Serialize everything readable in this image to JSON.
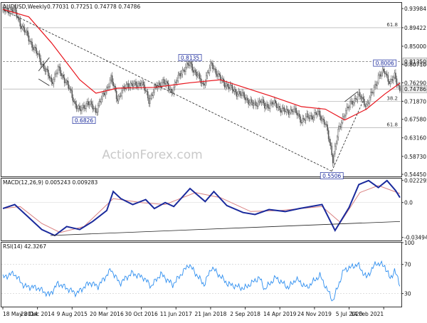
{
  "header": {
    "symbol": "AUDUSD,Weekly",
    "ohlc": "0.77031 0.77251 0.74778 0.74786"
  },
  "watermark": "ActionForex.com",
  "colors": {
    "background": "#ffffff",
    "candle": "#555555",
    "ma_line": "#e8141c",
    "macd_line": "#1a2a9c",
    "signal_line": "#d98080",
    "rsi_line": "#2f8ff0",
    "fib_line": "#b8b8b8",
    "trend_line": "#222222",
    "text": "#111111"
  },
  "chart_data": [
    {
      "type": "candlestick",
      "panel": "price",
      "title": "AUDUSD,Weekly",
      "ylim": [
        0.5395,
        0.9535
      ],
      "y_ticks": [
        0.93984,
        0.89422,
        0.85,
        0.8071,
        0.7629,
        0.7187,
        0.6758,
        0.6316,
        0.5873,
        0.5445
      ],
      "y_tick_labels": [
        "0.93984",
        "0.89422",
        "0.85000",
        "0.80710",
        "0.76290",
        "0.71870",
        "0.67580",
        "0.63160",
        "0.58730",
        "0.54450"
      ],
      "x_tick_labels": [
        "18 May 2014",
        "28 Dec 2014",
        "9 Aug 2015",
        "20 Mar 2016",
        "30 Oct 2016",
        "11 Jun 2017",
        "21 Jan 2018",
        "2 Sep 2018",
        "14 Apr 2019",
        "24 Nov 2019",
        "5 Jul 2020",
        "14 Feb 2021"
      ],
      "close_anchors": [
        {
          "date": "2014-05-18",
          "value": 0.934
        },
        {
          "date": "2014-07-27",
          "value": 0.938
        },
        {
          "date": "2014-09-07",
          "value": 0.905
        },
        {
          "date": "2014-11-02",
          "value": 0.868
        },
        {
          "date": "2015-01-25",
          "value": 0.81
        },
        {
          "date": "2015-03-29",
          "value": 0.765
        },
        {
          "date": "2015-05-10",
          "value": 0.795
        },
        {
          "date": "2015-06-28",
          "value": 0.768
        },
        {
          "date": "2015-08-30",
          "value": 0.712
        },
        {
          "date": "2015-09-27",
          "value": 0.695
        },
        {
          "date": "2015-11-15",
          "value": 0.716
        },
        {
          "date": "2016-01-10",
          "value": 0.697
        },
        {
          "date": "2016-03-13",
          "value": 0.745
        },
        {
          "date": "2016-04-17",
          "value": 0.772
        },
        {
          "date": "2016-05-29",
          "value": 0.725
        },
        {
          "date": "2016-07-31",
          "value": 0.76
        },
        {
          "date": "2016-09-18",
          "value": 0.756
        },
        {
          "date": "2016-10-30",
          "value": 0.765
        },
        {
          "date": "2016-12-18",
          "value": 0.722
        },
        {
          "date": "2017-01-22",
          "value": 0.748
        },
        {
          "date": "2017-03-19",
          "value": 0.767
        },
        {
          "date": "2017-05-14",
          "value": 0.742
        },
        {
          "date": "2017-07-16",
          "value": 0.79
        },
        {
          "date": "2017-09-10",
          "value": 0.808
        },
        {
          "date": "2017-12-03",
          "value": 0.758
        },
        {
          "date": "2018-01-28",
          "value": 0.808
        },
        {
          "date": "2018-03-25",
          "value": 0.77
        },
        {
          "date": "2018-06-17",
          "value": 0.745
        },
        {
          "date": "2018-08-26",
          "value": 0.73
        },
        {
          "date": "2018-10-28",
          "value": 0.708
        },
        {
          "date": "2018-12-09",
          "value": 0.722
        },
        {
          "date": "2019-01-06",
          "value": 0.705
        },
        {
          "date": "2019-02-24",
          "value": 0.715
        },
        {
          "date": "2019-05-26",
          "value": 0.692
        },
        {
          "date": "2019-07-07",
          "value": 0.7
        },
        {
          "date": "2019-09-01",
          "value": 0.674
        },
        {
          "date": "2019-12-15",
          "value": 0.69
        },
        {
          "date": "2020-02-02",
          "value": 0.668
        },
        {
          "date": "2020-03-22",
          "value": 0.581
        },
        {
          "date": "2020-04-19",
          "value": 0.636
        },
        {
          "date": "2020-06-07",
          "value": 0.694
        },
        {
          "date": "2020-07-26",
          "value": 0.716
        },
        {
          "date": "2020-08-30",
          "value": 0.735
        },
        {
          "date": "2020-10-25",
          "value": 0.71
        },
        {
          "date": "2020-12-06",
          "value": 0.742
        },
        {
          "date": "2021-01-10",
          "value": 0.778
        },
        {
          "date": "2021-02-21",
          "value": 0.79
        },
        {
          "date": "2021-03-28",
          "value": 0.762
        },
        {
          "date": "2021-04-25",
          "value": 0.778
        },
        {
          "date": "2021-05-30",
          "value": 0.7478
        }
      ],
      "moving_average_anchors": [
        {
          "date": "2014-05-18",
          "value": 0.938
        },
        {
          "date": "2014-11-02",
          "value": 0.92
        },
        {
          "date": "2015-03-29",
          "value": 0.858
        },
        {
          "date": "2015-09-27",
          "value": 0.77
        },
        {
          "date": "2016-01-10",
          "value": 0.738
        },
        {
          "date": "2016-05-29",
          "value": 0.75
        },
        {
          "date": "2017-01-22",
          "value": 0.752
        },
        {
          "date": "2017-09-10",
          "value": 0.763
        },
        {
          "date": "2018-03-25",
          "value": 0.77
        },
        {
          "date": "2019-02-24",
          "value": 0.73
        },
        {
          "date": "2019-09-01",
          "value": 0.706
        },
        {
          "date": "2020-02-02",
          "value": 0.7
        },
        {
          "date": "2020-06-07",
          "value": 0.674
        },
        {
          "date": "2020-10-25",
          "value": 0.7
        },
        {
          "date": "2021-02-21",
          "value": 0.736
        },
        {
          "date": "2021-05-30",
          "value": 0.762
        }
      ],
      "price_labels": [
        {
          "text": "0.6826",
          "date": "2015-10-25",
          "value": 0.6826
        },
        {
          "text": "0.8135",
          "date": "2017-09-10",
          "value": 0.8135
        },
        {
          "text": "0.5506",
          "date": "2020-03-15",
          "value": 0.5506
        },
        {
          "text": "0.8006",
          "date": "2021-02-21",
          "value": 0.8006
        }
      ],
      "horizontal_levels": [
        {
          "value": 0.89422,
          "label": "61.8",
          "style": "solid",
          "start": "2014-05-18"
        },
        {
          "value": 0.8135,
          "label": "0.81350",
          "style": "dashed",
          "start": "2014-05-18"
        },
        {
          "value": 0.74786,
          "label": "0.74786",
          "style": "solid",
          "start": "2014-05-18"
        },
        {
          "value": 0.7187,
          "label": "38.2",
          "style": "solid",
          "start": "2019-12-15"
        },
        {
          "value": 0.6556,
          "label": "61.8",
          "style": "solid",
          "start": "2020-02-16"
        }
      ],
      "trendlines": [
        {
          "from_date": "2014-05-25",
          "from": 0.936,
          "to_date": "2020-03-15",
          "to": 0.552,
          "style": "dashed"
        },
        {
          "from_date": "2020-03-15",
          "from": 0.552,
          "to_date": "2020-10-04",
          "to": 0.72,
          "style": "dashed"
        },
        {
          "from_date": "2015-01-04",
          "from": 0.791,
          "to_date": "2015-03-15",
          "to": 0.823,
          "style": "solid"
        },
        {
          "from_date": "2015-01-04",
          "from": 0.772,
          "to_date": "2015-03-15",
          "to": 0.756,
          "style": "solid"
        },
        {
          "from_date": "2020-06-07",
          "from": 0.718,
          "to_date": "2020-08-30",
          "to": 0.742,
          "style": "solid"
        }
      ]
    },
    {
      "type": "line",
      "panel": "macd",
      "title": "MACD(12,26,9) 0.005243 0.009283",
      "ylim": [
        -0.038,
        0.024
      ],
      "y_ticks": [
        0.022295,
        0.0,
        -0.034948
      ],
      "y_tick_labels": [
        "0.022295",
        "0.0",
        "-0.034948"
      ],
      "series": [
        {
          "role": "macd",
          "points": [
            {
              "date": "2014-05-18",
              "value": -0.006
            },
            {
              "date": "2014-08-03",
              "value": -0.002
            },
            {
              "date": "2014-10-19",
              "value": -0.013
            },
            {
              "date": "2015-01-25",
              "value": -0.027
            },
            {
              "date": "2015-04-19",
              "value": -0.033
            },
            {
              "date": "2015-07-05",
              "value": -0.024
            },
            {
              "date": "2015-09-27",
              "value": -0.027
            },
            {
              "date": "2015-12-20",
              "value": -0.019
            },
            {
              "date": "2016-03-20",
              "value": -0.008
            },
            {
              "date": "2016-05-01",
              "value": 0.011
            },
            {
              "date": "2016-06-19",
              "value": 0.004
            },
            {
              "date": "2016-09-04",
              "value": -0.002
            },
            {
              "date": "2016-11-27",
              "value": 0.003
            },
            {
              "date": "2017-01-22",
              "value": -0.006
            },
            {
              "date": "2017-04-02",
              "value": 0.0
            },
            {
              "date": "2017-05-28",
              "value": -0.004
            },
            {
              "date": "2017-09-10",
              "value": 0.014
            },
            {
              "date": "2017-12-17",
              "value": 0.001
            },
            {
              "date": "2018-02-11",
              "value": 0.011
            },
            {
              "date": "2018-05-06",
              "value": -0.003
            },
            {
              "date": "2018-08-19",
              "value": -0.01
            },
            {
              "date": "2018-11-04",
              "value": -0.012
            },
            {
              "date": "2019-02-03",
              "value": -0.007
            },
            {
              "date": "2019-05-19",
              "value": -0.009
            },
            {
              "date": "2019-08-18",
              "value": -0.006
            },
            {
              "date": "2020-01-12",
              "value": -0.002
            },
            {
              "date": "2020-04-05",
              "value": -0.028
            },
            {
              "date": "2020-07-05",
              "value": -0.005
            },
            {
              "date": "2020-09-06",
              "value": 0.018
            },
            {
              "date": "2020-11-08",
              "value": 0.022
            },
            {
              "date": "2021-01-10",
              "value": 0.015
            },
            {
              "date": "2021-03-07",
              "value": 0.022
            },
            {
              "date": "2021-05-02",
              "value": 0.012
            },
            {
              "date": "2021-05-30",
              "value": 0.005
            }
          ]
        },
        {
          "role": "signal",
          "points": [
            {
              "date": "2014-05-18",
              "value": -0.006
            },
            {
              "date": "2014-09-07",
              "value": -0.004
            },
            {
              "date": "2015-01-25",
              "value": -0.021
            },
            {
              "date": "2015-05-24",
              "value": -0.03
            },
            {
              "date": "2015-10-25",
              "value": -0.024
            },
            {
              "date": "2016-05-01",
              "value": 0.004
            },
            {
              "date": "2016-10-30",
              "value": 0.0
            },
            {
              "date": "2017-04-02",
              "value": -0.002
            },
            {
              "date": "2017-10-15",
              "value": 0.01
            },
            {
              "date": "2018-03-25",
              "value": 0.005
            },
            {
              "date": "2018-10-07",
              "value": -0.009
            },
            {
              "date": "2019-04-14",
              "value": -0.008
            },
            {
              "date": "2020-01-12",
              "value": -0.004
            },
            {
              "date": "2020-05-10",
              "value": -0.02
            },
            {
              "date": "2020-09-13",
              "value": 0.01
            },
            {
              "date": "2021-01-10",
              "value": 0.017
            },
            {
              "date": "2021-05-30",
              "value": 0.009
            }
          ]
        }
      ],
      "trendlines": [
        {
          "from_date": "2015-03-22",
          "from": -0.033,
          "to_date": "2021-05-30",
          "to": -0.019
        }
      ]
    },
    {
      "type": "line",
      "panel": "rsi",
      "title": "RSI(14) 42.3267",
      "ylim": [
        12,
        100
      ],
      "y_ticks": [
        100,
        70,
        30
      ],
      "y_tick_labels": [
        "100",
        "70",
        "30"
      ],
      "series": [
        {
          "role": "rsi",
          "points": [
            {
              "date": "2014-05-18",
              "value": 52
            },
            {
              "date": "2014-07-27",
              "value": 58
            },
            {
              "date": "2014-10-05",
              "value": 40
            },
            {
              "date": "2014-12-28",
              "value": 38
            },
            {
              "date": "2015-03-15",
              "value": 28
            },
            {
              "date": "2015-05-10",
              "value": 44
            },
            {
              "date": "2015-09-06",
              "value": 30
            },
            {
              "date": "2015-11-29",
              "value": 45
            },
            {
              "date": "2016-01-24",
              "value": 40
            },
            {
              "date": "2016-04-17",
              "value": 63
            },
            {
              "date": "2016-06-12",
              "value": 44
            },
            {
              "date": "2016-08-28",
              "value": 58
            },
            {
              "date": "2016-11-13",
              "value": 52
            },
            {
              "date": "2017-01-01",
              "value": 40
            },
            {
              "date": "2017-03-05",
              "value": 57
            },
            {
              "date": "2017-05-21",
              "value": 42
            },
            {
              "date": "2017-09-03",
              "value": 70
            },
            {
              "date": "2017-12-10",
              "value": 42
            },
            {
              "date": "2018-01-28",
              "value": 66
            },
            {
              "date": "2018-05-13",
              "value": 43
            },
            {
              "date": "2018-08-26",
              "value": 37
            },
            {
              "date": "2018-12-02",
              "value": 52
            },
            {
              "date": "2019-01-06",
              "value": 36
            },
            {
              "date": "2019-03-17",
              "value": 52
            },
            {
              "date": "2019-06-09",
              "value": 38
            },
            {
              "date": "2019-07-28",
              "value": 50
            },
            {
              "date": "2019-10-06",
              "value": 38
            },
            {
              "date": "2019-12-29",
              "value": 55
            },
            {
              "date": "2020-03-22",
              "value": 20
            },
            {
              "date": "2020-05-31",
              "value": 62
            },
            {
              "date": "2020-08-30",
              "value": 70
            },
            {
              "date": "2020-10-25",
              "value": 52
            },
            {
              "date": "2020-12-27",
              "value": 72
            },
            {
              "date": "2021-02-21",
              "value": 68
            },
            {
              "date": "2021-03-28",
              "value": 50
            },
            {
              "date": "2021-04-25",
              "value": 62
            },
            {
              "date": "2021-05-30",
              "value": 42
            }
          ]
        }
      ]
    }
  ]
}
